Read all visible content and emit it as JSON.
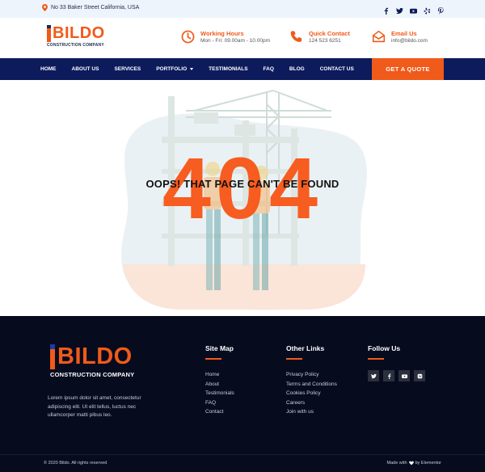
{
  "topbar": {
    "address": "No 33 Baker Street California, USA",
    "social_icons": [
      "facebook-icon",
      "twitter-icon",
      "youtube-icon",
      "yelp-icon",
      "pinterest-icon"
    ]
  },
  "brand": {
    "name": "BILDO",
    "tagline": "CONSTRUCTION COMPANY"
  },
  "header_info": [
    {
      "icon": "clock-icon",
      "title": "Working Hours",
      "detail": "Mon - Fri: 09.00am - 10.00pm"
    },
    {
      "icon": "phone-icon",
      "title": "Quick Contact",
      "detail": "124 523 6251"
    },
    {
      "icon": "envelope-icon",
      "title": "Email Us",
      "detail": "info@bildo.com"
    }
  ],
  "nav": {
    "items": [
      "HOME",
      "ABOUT US",
      "SERVICES",
      "PORTFOLIO",
      "TESTIMONIALS",
      "FAQ",
      "BLOG",
      "CONTACT US"
    ],
    "cta": "GET A QUOTE"
  },
  "error": {
    "code": "404",
    "message": "OOPS! THAT PAGE CAN'T BE FOUND"
  },
  "footer": {
    "description": "Lorem ipsum dolor sit amet, consectetur adipiscing elit. Ut elit tellus, luctus nec ullamcorper matti pibus leo.",
    "sitemap": {
      "title": "Site Map",
      "links": [
        "Home",
        "About",
        "Testimonials",
        "FAQ",
        "Contact"
      ]
    },
    "other_links": {
      "title": "Other Links",
      "links": [
        "Privacy Policy",
        "Terms and Conditions",
        "Cookies Policy",
        "Careers",
        "Join with us"
      ]
    },
    "follow": {
      "title": "Follow Us",
      "icons": [
        "twitter-icon",
        "facebook-icon",
        "youtube-icon",
        "vk-icon"
      ]
    }
  },
  "bottom": {
    "copyright": "© 2020 Bildo. All rights reserved",
    "made_with_prefix": "Made with",
    "made_with_suffix": "by Elementor"
  },
  "colors": {
    "accent": "#f05a1a",
    "navy": "#0d1b5c",
    "footer_bg": "#060b1e"
  }
}
